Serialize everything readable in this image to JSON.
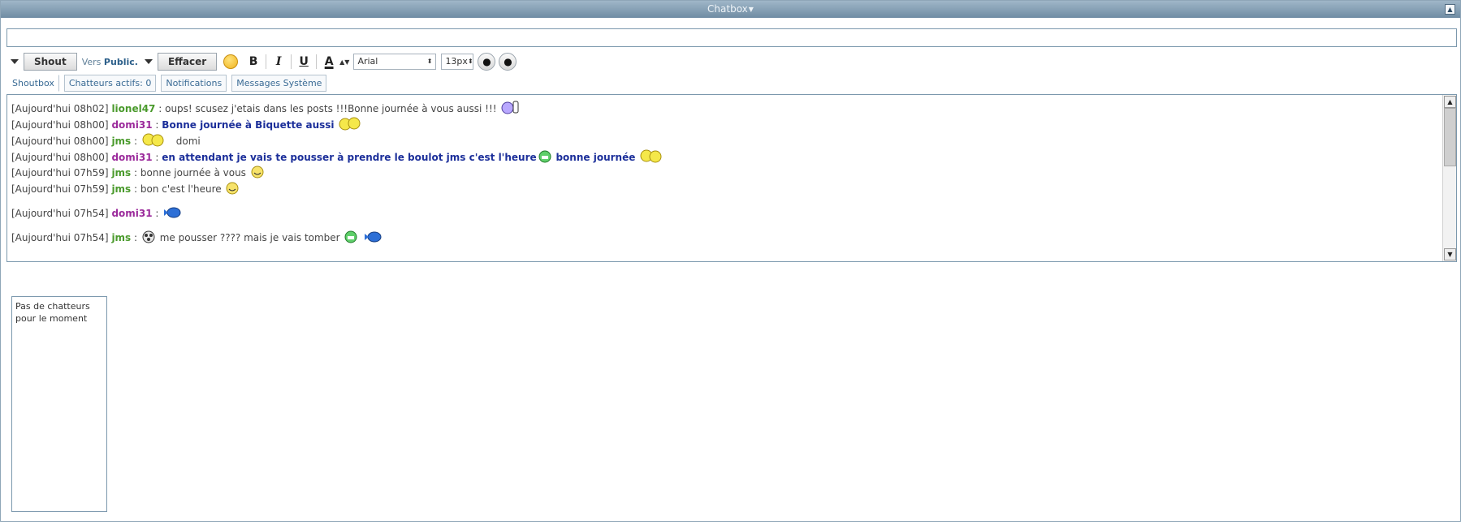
{
  "window": {
    "title": "Chatbox"
  },
  "toolbar": {
    "shout_label": "Shout",
    "vers_label": "Vers",
    "vers_target": "Public.",
    "effacer_label": "Effacer",
    "bold_label": "B",
    "italic_label": "I",
    "underline_label": "U",
    "color_label": "A",
    "font_select": "Arial",
    "size_select": "13px"
  },
  "tabs": [
    {
      "label": "Shoutbox"
    },
    {
      "label": "Chatteurs actifs: 0"
    },
    {
      "label": "Notifications"
    },
    {
      "label": "Messages Système"
    }
  ],
  "messages": [
    {
      "time": "[Aujourd'hui 08h02]",
      "user": "lionel47",
      "text": "oups! scusez j'etais dans les posts !!!Bonne journée à vous aussi !!!"
    },
    {
      "time": "[Aujourd'hui 08h00]",
      "user": "domi31",
      "text": "Bonne journée à Biquette aussi"
    },
    {
      "time": "[Aujourd'hui 08h00]",
      "user": "jms",
      "text": "domi"
    },
    {
      "time": "[Aujourd'hui 08h00]",
      "user": "domi31",
      "text": "en attendant je vais te pousser à prendre le boulot jms c'est l'heure",
      "text2": "bonne journée"
    },
    {
      "time": "[Aujourd'hui 07h59]",
      "user": "jms",
      "text": "bonne journée à vous"
    },
    {
      "time": "[Aujourd'hui 07h59]",
      "user": "jms",
      "text": "bon c'est l'heure"
    },
    {
      "time": "[Aujourd'hui 07h54]",
      "user": "domi31",
      "text": ""
    },
    {
      "time": "[Aujourd'hui 07h54]",
      "user": "jms",
      "text": "me pousser ???? mais je vais tomber"
    }
  ],
  "sep": ":",
  "users_panel": {
    "empty_text": "Pas de chatteurs pour le moment"
  },
  "colors": {
    "titlebar": "#7f9ab0",
    "user_green": "#4a9a2c",
    "user_purple": "#9b2a9b",
    "bold_blue": "#1c2f9a",
    "tab_text": "#3a6b95"
  }
}
